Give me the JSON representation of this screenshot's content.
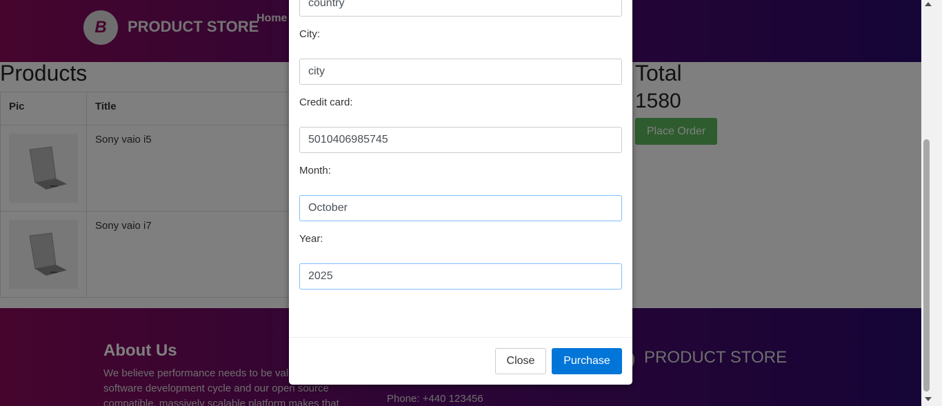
{
  "navbar": {
    "brand": "PRODUCT STORE",
    "logo_letter": "B",
    "home_link": "Home"
  },
  "products": {
    "title": "Products",
    "columns": [
      "Pic",
      "Title"
    ],
    "rows": [
      {
        "title": "Sony vaio i5"
      },
      {
        "title": "Sony vaio i7"
      }
    ]
  },
  "summary": {
    "total_label": "Total",
    "total_value": "1580",
    "place_order_label": "Place Order"
  },
  "footer": {
    "about_title": "About Us",
    "about_text": "We believe performance needs to be valid stage of the software development cycle and our open source compatible, massively scalable platform makes that",
    "phone": "Phone: +440 123456",
    "brand": "PRODUCT STORE"
  },
  "modal": {
    "country_value": "country",
    "city_label": "City:",
    "city_value": "city",
    "card_label": "Credit card:",
    "card_value": "5010406985745",
    "month_label": "Month:",
    "month_value": "October",
    "year_label": "Year:",
    "year_value": "2025",
    "close_label": "Close",
    "purchase_label": "Purchase"
  },
  "colors": {
    "purchase_button": "#0275d8",
    "place_order_button": "#5cb85c",
    "navbar_start": "#8b0a5b",
    "navbar_end": "#2c0a6e"
  }
}
